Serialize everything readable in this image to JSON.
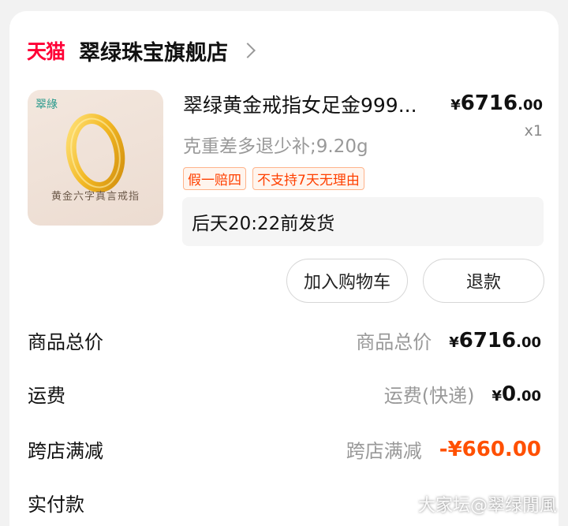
{
  "store": {
    "logo": "天猫",
    "name": "翠绿珠宝旗舰店"
  },
  "product": {
    "image_brand": "翠綠",
    "image_caption": "黄金六字真言戒指",
    "title": "翠绿黄金戒指女足金999...",
    "price_symbol": "¥",
    "price_int": "6716",
    "price_dec": ".00",
    "quantity": "x1",
    "spec": "克重差多退少补;9.20g",
    "tags": [
      "假一赔四",
      "不支持7天无理由"
    ],
    "delivery": "后天20:22前发货"
  },
  "actions": {
    "add_to_cart": "加入购物车",
    "refund": "退款"
  },
  "summary": {
    "total_label": "商品总价",
    "total_sub": "商品总价",
    "total_symbol": "¥",
    "total_int": "6716",
    "total_dec": ".00",
    "shipping_label": "运费",
    "shipping_sub": "运费(快递)",
    "shipping_symbol": "¥",
    "shipping_int": "0",
    "shipping_dec": ".00",
    "discount_label": "跨店满减",
    "discount_sub": "跨店满减",
    "discount_value": "-¥660.00",
    "paid_label": "实付款"
  },
  "watermark": "大家坛@翠绿閒風",
  "colors": {
    "brand": "#ff0036",
    "discount": "#ff5000",
    "tag_text": "#ff4000"
  }
}
